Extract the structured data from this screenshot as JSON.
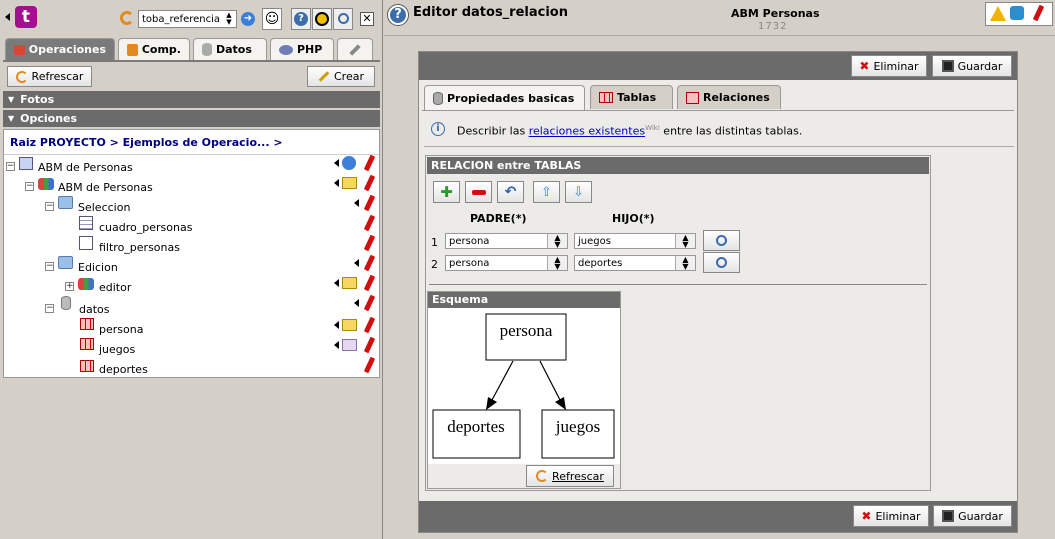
{
  "left": {
    "project_select": "toba_referencia",
    "tabs": [
      "Operaciones",
      "Comp.",
      "Datos",
      "PHP"
    ],
    "refresh_label": "Refrescar",
    "create_label": "Crear",
    "sections": [
      "Fotos",
      "Opciones"
    ],
    "breadcrumb": "Raiz PROYECTO > Ejemplos de Operacio... >",
    "tree": [
      {
        "label": "ABM de Personas"
      },
      {
        "label": "ABM de Personas"
      },
      {
        "label": "Seleccion"
      },
      {
        "label": "cuadro_personas"
      },
      {
        "label": "filtro_personas"
      },
      {
        "label": "Edicion"
      },
      {
        "label": "editor"
      },
      {
        "label": "datos"
      },
      {
        "label": "persona"
      },
      {
        "label": "juegos"
      },
      {
        "label": "deportes"
      }
    ]
  },
  "header": {
    "title": "Editor datos_relacion",
    "subtitle": "ABM Personas",
    "id": "1732"
  },
  "editor": {
    "delete_label": "Eliminar",
    "save_label": "Guardar",
    "tabs": [
      "Propiedades basicas",
      "Tablas",
      "Relaciones"
    ],
    "info_prefix": "Describir las",
    "info_link": "relaciones existentes",
    "info_sup": "Wiki",
    "info_suffix": "entre las distintas tablas.",
    "relation_title": "RELACION entre TABLAS",
    "col_parent": "PADRE(*)",
    "col_child": "HIJO(*)",
    "rows": [
      {
        "n": "1",
        "parent": "persona",
        "child": "juegos"
      },
      {
        "n": "2",
        "parent": "persona",
        "child": "deportes"
      }
    ],
    "schema_title": "Esquema",
    "schema_nodes": [
      "persona",
      "deportes",
      "juegos"
    ],
    "schema_refresh": "Refrescar"
  },
  "colors": {
    "accent": "#6b6b6b",
    "link": "#0000cc",
    "danger": "#d01010"
  }
}
